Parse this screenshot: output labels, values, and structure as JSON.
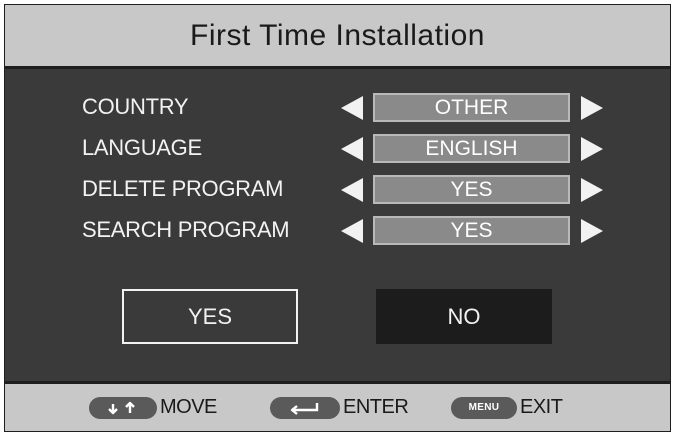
{
  "title": "First Time Installation",
  "settings": [
    {
      "label": "COUNTRY",
      "value": "OTHER"
    },
    {
      "label": "LANGUAGE",
      "value": "ENGLISH"
    },
    {
      "label": "DELETE PROGRAM",
      "value": "YES"
    },
    {
      "label": "SEARCH PROGRAM",
      "value": "YES"
    }
  ],
  "buttons": {
    "yes": "YES",
    "no": "NO"
  },
  "footer": {
    "move": "MOVE",
    "enter": "ENTER",
    "menu_key": "MENU",
    "exit": "EXIT"
  },
  "colors": {
    "header_bg": "#c8c8c8",
    "panel_bg": "#3a3a3a",
    "value_box": "#8a8a8a",
    "no_button_bg": "#1c1c1c"
  }
}
